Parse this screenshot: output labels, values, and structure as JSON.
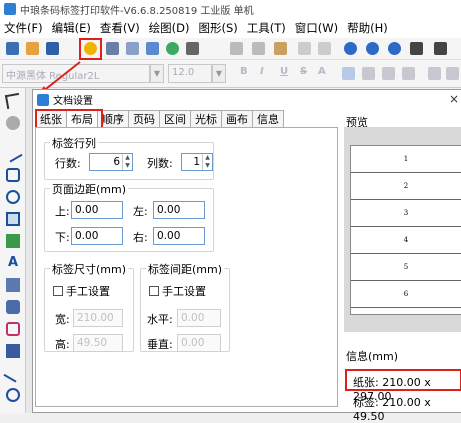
{
  "app": {
    "title": "中琅条码标签打印软件-V6.6.8.250819 工业版 单机"
  },
  "menu": {
    "items": [
      "文件(F)",
      "编辑(E)",
      "查看(V)",
      "绘图(D)",
      "图形(S)",
      "工具(T)",
      "窗口(W)",
      "帮助(H)"
    ]
  },
  "toolbar": {
    "font_name": "中源黑体 Regular2L",
    "font_size": "12.0",
    "bold": "B",
    "italic": "I",
    "underline": "U",
    "strike": "S",
    "color": "A"
  },
  "dialog": {
    "title": "文档设置",
    "tabs": [
      "纸张",
      "布局",
      "顺序",
      "页码",
      "区间",
      "光标",
      "画布",
      "信息"
    ],
    "active_tab": "布局",
    "label_rows": {
      "group_title": "标签行列",
      "rows_label": "行数:",
      "rows_value": "6",
      "cols_label": "列数:",
      "cols_value": "1"
    },
    "page_margin": {
      "group_title": "页面边距(mm)",
      "top_label": "上:",
      "top_value": "0.00",
      "left_label": "左:",
      "left_value": "0.00",
      "bottom_label": "下:",
      "bottom_value": "0.00",
      "right_label": "右:",
      "right_value": "0.00"
    },
    "label_size": {
      "group_title": "标签尺寸(mm)",
      "manual_label": "手工设置",
      "width_label": "宽:",
      "width_value": "210.00",
      "height_label": "高:",
      "height_value": "49.50"
    },
    "label_spacing": {
      "group_title": "标签间距(mm)",
      "manual_label": "手工设置",
      "horizontal_label": "水平:",
      "horizontal_value": "0.00",
      "vertical_label": "垂直:",
      "vertical_value": "0.00"
    },
    "preview": {
      "title": "预览",
      "rows": [
        "1",
        "2",
        "3",
        "4",
        "5",
        "6"
      ]
    },
    "info": {
      "title": "信息(mm)",
      "paper": "纸张: 210.00 x 297.00",
      "label": "标签: 210.00 x 49.50"
    }
  },
  "colors": {
    "highlight": "#e0201a",
    "accent": "#2d7fd3"
  }
}
